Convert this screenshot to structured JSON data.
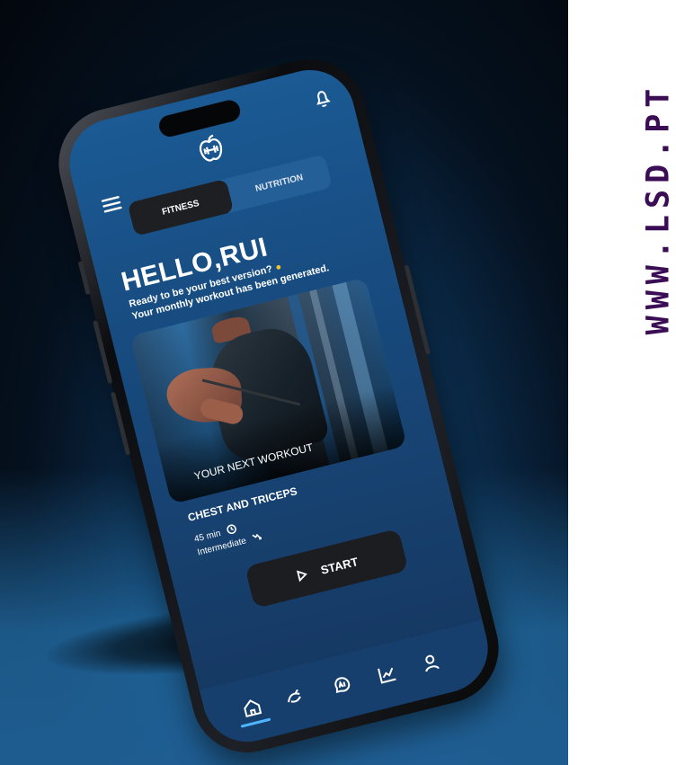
{
  "brand": {
    "site": "WWW.LSD.PT",
    "text_color": "#3b0d54"
  },
  "app": {
    "tabs": [
      {
        "label": "FITNESS",
        "active": true
      },
      {
        "label": "NUTRITION",
        "active": false
      }
    ],
    "greeting": "HELLO,RUI",
    "intro_lines": [
      "Ready to be your best version?",
      "Your monthly workout has been generated."
    ],
    "workout_card": {
      "label": "YOUR NEXT WORKOUT",
      "title": "CHEST AND TRICEPS",
      "duration": "45 min",
      "level": "Intermediate",
      "button_label": "START"
    },
    "icons": {
      "logo": "apple-dumbbell-icon",
      "notifications": "bell-icon",
      "menu": "hamburger-menu-icon",
      "muscle": "flexed-biceps-icon",
      "clock": "clock-icon",
      "level": "trend-icon",
      "start": "play-icon",
      "nav": [
        "home-icon",
        "training-icon",
        "ai-icon",
        "progress-chart-icon",
        "profile-icon"
      ]
    },
    "colors": {
      "screen_blue": "#17497c",
      "dark_surface": "#1b1d21",
      "accent_blue": "#4eb4ff",
      "muscle_icon": "#f7c22b"
    }
  }
}
